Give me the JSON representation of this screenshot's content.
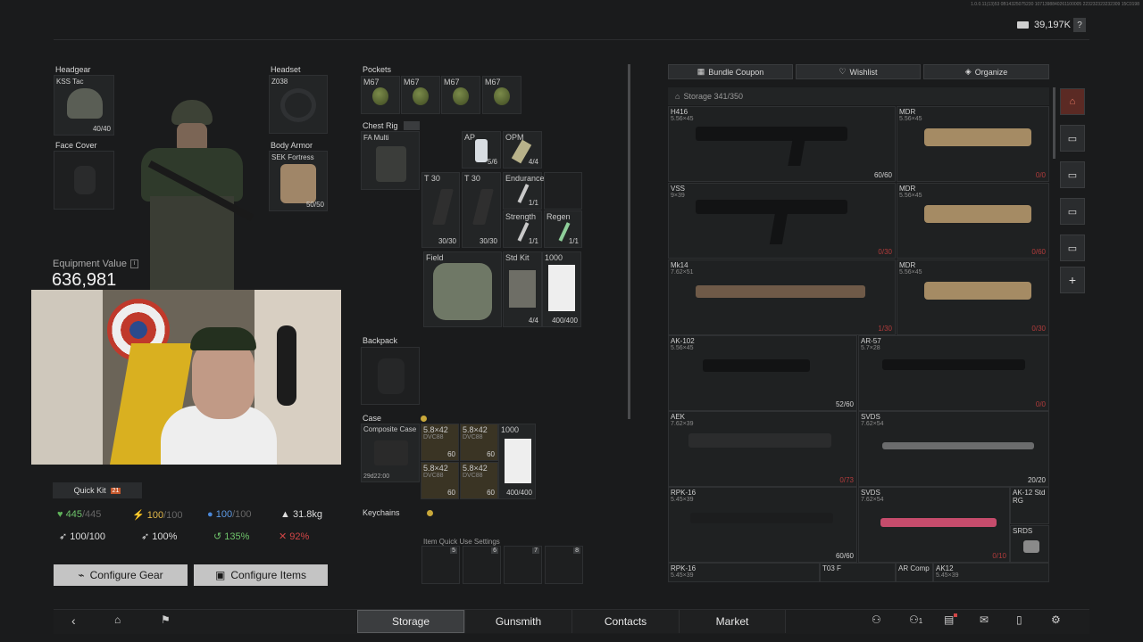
{
  "header": {
    "currency": "39,197K",
    "help": "?",
    "build_text": "1.0.0.11(13)53 0B14325075230 1071398840261100005 223232323232309 15C0198"
  },
  "gear": {
    "headgear": {
      "label": "Headgear",
      "name": "KSS Tac",
      "count": "40/40"
    },
    "headset": {
      "label": "Headset",
      "name": "Z038"
    },
    "face_cover": {
      "label": "Face Cover"
    },
    "body_armor": {
      "label": "Body Armor",
      "name": "SEK Fortress",
      "count": "50/50"
    },
    "equipment_value_label": "Equipment Value",
    "equipment_value": "636,981"
  },
  "pockets": {
    "label": "Pockets",
    "items": [
      "M67",
      "M67",
      "M67",
      "M67"
    ]
  },
  "chest_rig": {
    "label": "Chest Rig",
    "name": "FA Multi",
    "items": {
      "ap": "AP",
      "ap_count": "5/6",
      "opm": "OPM",
      "opm_count": "4/4",
      "t30a": "T 30",
      "t30a_count": "30/30",
      "t30b": "T 30",
      "t30b_count": "30/30",
      "endurance": "Endurance",
      "endurance_count": "1/1",
      "strength": "Strength",
      "strength_count": "1/1",
      "regen": "Regen",
      "regen_count": "1/1",
      "field": "Field",
      "stdkit": "Std Kit",
      "stdkit_count": "4/4",
      "k1000": "1000",
      "k1000_count": "400/400"
    }
  },
  "backpack": {
    "label": "Backpack"
  },
  "case": {
    "label": "Case",
    "name": "Composite Case",
    "timer": "29d22:00",
    "items": [
      {
        "name": "5.8×42",
        "sub": "DVC88",
        "count": "60"
      },
      {
        "name": "5.8×42",
        "sub": "DVC88",
        "count": "60"
      },
      {
        "name": "5.8×42",
        "sub": "DVC88",
        "count": "60"
      },
      {
        "name": "5.8×42",
        "sub": "DVC88",
        "count": "60"
      }
    ],
    "bag": "1000",
    "bag_count": "400/400"
  },
  "keychains": {
    "label": "Keychains"
  },
  "quick_use": {
    "label": "Item Quick Use Settings",
    "keys": [
      "5",
      "6",
      "7",
      "8"
    ]
  },
  "quick_kit": {
    "label": "Quick Kit",
    "badge": "21"
  },
  "stats": {
    "health": "445",
    "health_max": "/445",
    "energy": "100",
    "energy_max": "/100",
    "water": "100",
    "water_max": "/100",
    "weight": "31.8kg",
    "s1": "100/100",
    "s2": "100%",
    "s3": "135%",
    "s4": "92%"
  },
  "buttons": {
    "configure_gear": "Configure Gear",
    "configure_items": "Configure Items"
  },
  "storage": {
    "bundle": "Bundle Coupon",
    "wishlist": "Wishlist",
    "organize": "Organize",
    "title": "Storage 341/350",
    "weapons": [
      {
        "name": "H416",
        "cal": "5.56×45",
        "count": "60/60"
      },
      {
        "name": "MDR",
        "cal": "5.56×45",
        "count": "0/0"
      },
      {
        "name": "VSS",
        "cal": "9×39",
        "count": "0/30"
      },
      {
        "name": "MDR",
        "cal": "5.56×45",
        "count": "0/60"
      },
      {
        "name": "Mk14",
        "cal": "7.62×51",
        "count": "1/30"
      },
      {
        "name": "MDR",
        "cal": "5.56×45",
        "count": "0/30"
      },
      {
        "name": "AK-102",
        "cal": "5.56×45",
        "count": "52/60"
      },
      {
        "name": "AR-57",
        "cal": "5.7×28",
        "count": "0/0"
      },
      {
        "name": "AEK",
        "cal": "7.62×39",
        "count": "0/73"
      },
      {
        "name": "SVDS",
        "cal": "7.62×54",
        "count": "20/20"
      },
      {
        "name": "RPK-16",
        "cal": "5.45×39",
        "count": "60/60"
      },
      {
        "name": "SVDS",
        "cal": "7.62×54",
        "count": "0/10"
      },
      {
        "name": "AK-12 Std RG",
        "cal": ""
      },
      {
        "name": "SRDS",
        "cal": ""
      },
      {
        "name": "RPK-16",
        "cal": "5.45×39"
      },
      {
        "name": "T03 F",
        "cal": ""
      },
      {
        "name": "AR Comp",
        "cal": ""
      },
      {
        "name": "AK12",
        "cal": "5.45×39"
      }
    ]
  },
  "nav": {
    "storage": "Storage",
    "gunsmith": "Gunsmith",
    "contacts": "Contacts",
    "market": "Market",
    "friends_count": "1"
  }
}
